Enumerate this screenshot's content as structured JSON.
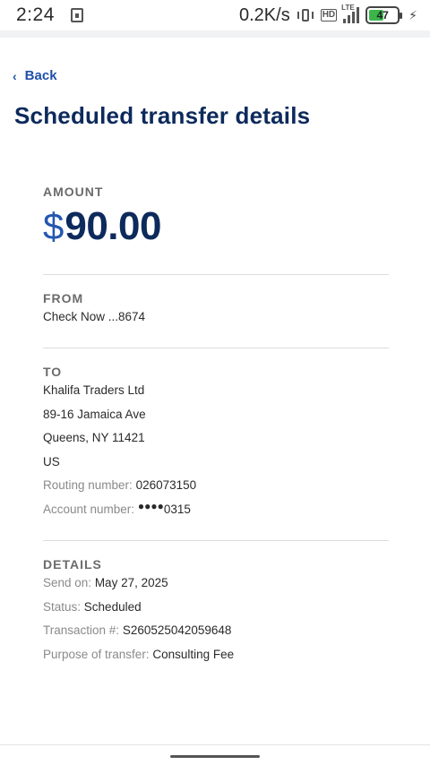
{
  "status_bar": {
    "time": "2:24",
    "speed": "0.2K/s",
    "hd": "HD",
    "network": "LTE",
    "battery": "47",
    "battery_level": 0.47
  },
  "header": {
    "back_label": "Back",
    "title": "Scheduled transfer details"
  },
  "amount": {
    "label": "AMOUNT",
    "currency": "$",
    "value": "90.00"
  },
  "from": {
    "label": "FROM",
    "account": "Check Now ...8674"
  },
  "to": {
    "label": "TO",
    "name": "Khalifa Traders Ltd",
    "address1": "89-16 Jamaica Ave",
    "address2": "Queens, NY 11421",
    "country": "US",
    "routing_label": "Routing number:",
    "routing_value": "026073150",
    "account_label": "Account number:",
    "account_mask": "●●●●",
    "account_last": "0315"
  },
  "details": {
    "label": "DETAILS",
    "send_on_label": "Send on:",
    "send_on_value": "May 27, 2025",
    "status_label": "Status:",
    "status_value": "Scheduled",
    "transaction_label": "Transaction #:",
    "transaction_value": "S260525042059648",
    "purpose_label": "Purpose of transfer:",
    "purpose_value": "Consulting Fee"
  }
}
